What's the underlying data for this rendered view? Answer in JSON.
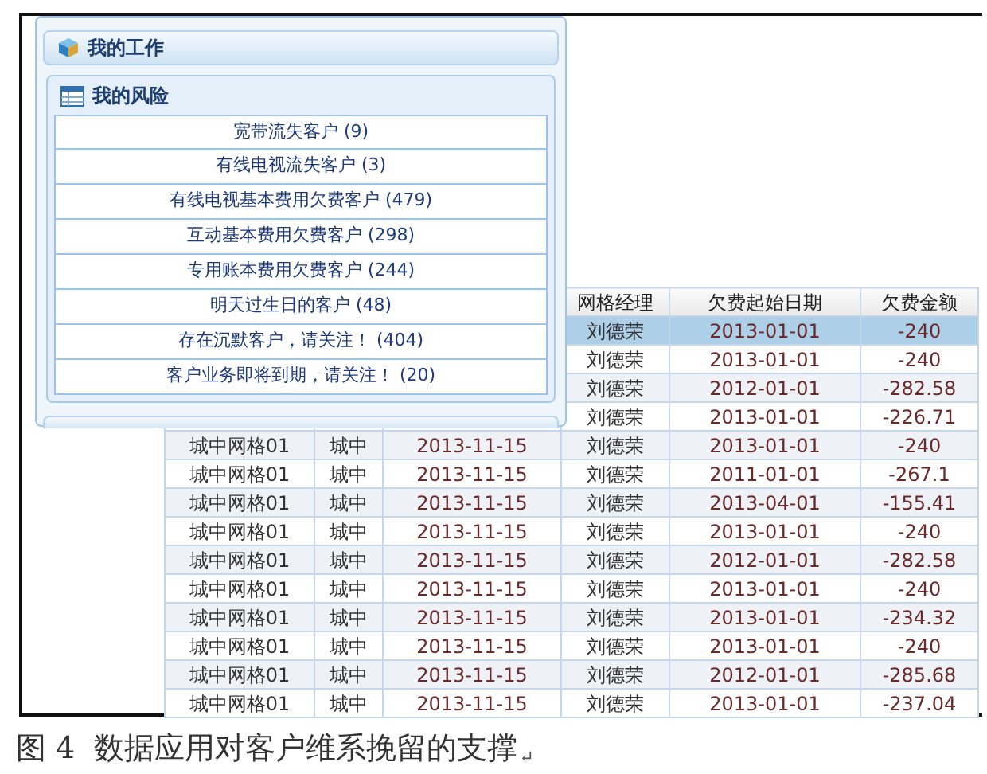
{
  "panel": {
    "title": "我的工作",
    "section": {
      "title": "我的风险",
      "items": [
        {
          "label": "宽带流失客户 (9)"
        },
        {
          "label": "有线电视流失客户 (3)"
        },
        {
          "label": "有线电视基本费用欠费客户 (479)"
        },
        {
          "label": "互动基本费用欠费客户 (298)"
        },
        {
          "label": "专用账本费用欠费客户 (244)"
        },
        {
          "label": "明天过生日的客户 (48)"
        },
        {
          "label": "存在沉默客户，请关注！ (404)"
        },
        {
          "label": "客户业务即将到期，请关注！ (20)"
        }
      ]
    }
  },
  "table": {
    "columns": [
      "网格经理",
      "欠费起始日期",
      "欠费金额"
    ],
    "rows": [
      {
        "selected": true,
        "cells": [
          "刘德荣",
          "2013-01-01",
          "-240"
        ]
      },
      {
        "selected": false,
        "cells": [
          "刘德荣",
          "2013-01-01",
          "-240"
        ]
      },
      {
        "selected": false,
        "cells": [
          "刘德荣",
          "2012-01-01",
          "-282.58"
        ]
      },
      {
        "selected": false,
        "cells": [
          "刘德荣",
          "2013-01-01",
          "-226.71"
        ]
      },
      {
        "selected": false,
        "cells": [
          "城中网格01",
          "城中",
          "2013-11-15",
          "刘德荣",
          "2013-01-01",
          "-240"
        ]
      },
      {
        "selected": false,
        "cells": [
          "城中网格01",
          "城中",
          "2013-11-15",
          "刘德荣",
          "2011-01-01",
          "-267.1"
        ]
      },
      {
        "selected": false,
        "cells": [
          "城中网格01",
          "城中",
          "2013-11-15",
          "刘德荣",
          "2013-04-01",
          "-155.41"
        ]
      },
      {
        "selected": false,
        "cells": [
          "城中网格01",
          "城中",
          "2013-11-15",
          "刘德荣",
          "2013-01-01",
          "-240"
        ]
      },
      {
        "selected": false,
        "cells": [
          "城中网格01",
          "城中",
          "2013-11-15",
          "刘德荣",
          "2012-01-01",
          "-282.58"
        ]
      },
      {
        "selected": false,
        "cells": [
          "城中网格01",
          "城中",
          "2013-11-15",
          "刘德荣",
          "2013-01-01",
          "-240"
        ]
      },
      {
        "selected": false,
        "cells": [
          "城中网格01",
          "城中",
          "2013-11-15",
          "刘德荣",
          "2013-01-01",
          "-234.32"
        ]
      },
      {
        "selected": false,
        "cells": [
          "城中网格01",
          "城中",
          "2013-11-15",
          "刘德荣",
          "2013-01-01",
          "-240"
        ]
      },
      {
        "selected": false,
        "cells": [
          "城中网格01",
          "城中",
          "2013-11-15",
          "刘德荣",
          "2012-01-01",
          "-285.68"
        ]
      },
      {
        "selected": false,
        "cells": [
          "城中网格01",
          "城中",
          "2013-11-15",
          "刘德荣",
          "2013-01-01",
          "-237.04"
        ]
      }
    ]
  },
  "caption": {
    "text": "图 4  数据应用对客户维系挽留的支撑",
    "mark": "↵"
  }
}
